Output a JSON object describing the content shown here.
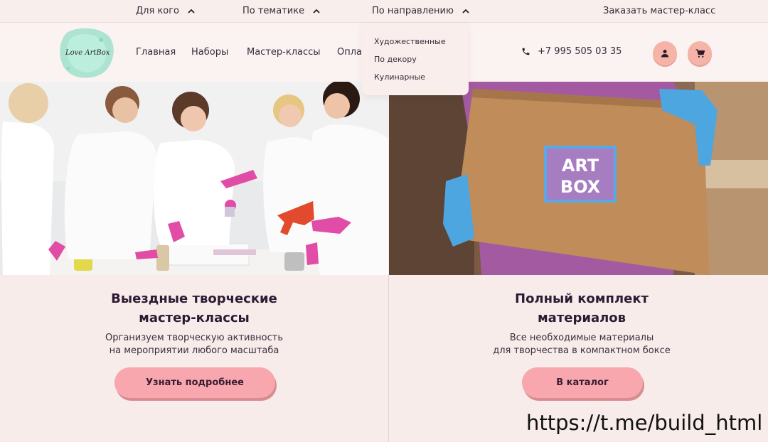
{
  "topbar": {
    "for_whom": "Для кого",
    "by_theme": "По тематике",
    "by_direction": "По направлению",
    "order": "Заказать мастер-класс"
  },
  "logo": {
    "text": "Love ArtBox"
  },
  "nav": {
    "home": "Главная",
    "sets": "Наборы",
    "masterclasses": "Мастер-классы",
    "payment": "Оплата"
  },
  "contact": {
    "phone": "+7 995 505 03 35"
  },
  "dropdown": {
    "items": [
      "Художественные",
      "По декору",
      "Кулинарные"
    ]
  },
  "images": {
    "right_box_label_line1": "ART",
    "right_box_label_line2": "BOX"
  },
  "cards": [
    {
      "title_line1": "Выездные творческие",
      "title_line2": "мастер-классы",
      "sub_line1": "Организуем творческую активность",
      "sub_line2": "на мероприятии любого масштаба",
      "button": "Узнать подробнее"
    },
    {
      "title_line1": "Полный комплект",
      "title_line2": "материалов",
      "sub_line1": "Все необходимые материалы",
      "sub_line2": "для творчества в компактном боксе",
      "button": "В каталог"
    }
  ],
  "watermark": "https://t.me/build_html",
  "colors": {
    "background": "#f7ecea",
    "accent_pink": "#f7a7ad",
    "icon_button": "#f6b4a8",
    "title": "#2e1a33"
  },
  "icons": [
    "chevron-up-icon",
    "phone-icon",
    "user-icon",
    "cart-icon"
  ]
}
